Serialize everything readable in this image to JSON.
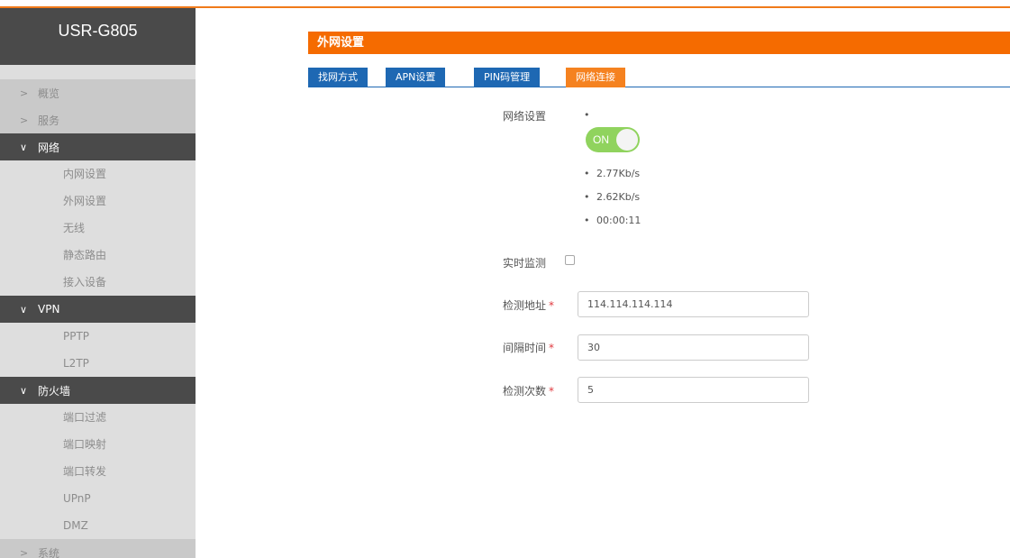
{
  "brand": "USR-G805",
  "sidebar": {
    "groups": [
      {
        "label": "概览",
        "chevron": ">",
        "open": false
      },
      {
        "label": "服务",
        "chevron": ">",
        "open": false
      },
      {
        "label": "网络",
        "chevron": "∨",
        "open": true,
        "items": [
          "内网设置",
          "外网设置",
          "无线",
          "静态路由",
          "接入设备"
        ]
      },
      {
        "label": "VPN",
        "chevron": "∨",
        "open": true,
        "items": [
          "PPTP",
          "L2TP"
        ]
      },
      {
        "label": "防火墙",
        "chevron": "∨",
        "open": true,
        "items": [
          "端口过滤",
          "端口映射",
          "端口转发",
          "UPnP",
          "DMZ"
        ]
      },
      {
        "label": "系统",
        "chevron": ">",
        "open": false
      }
    ]
  },
  "main": {
    "section_title": "外网设置",
    "tabs": [
      {
        "label": "找网方式",
        "active": false
      },
      {
        "label": "APN设置",
        "active": false
      },
      {
        "label": "PIN码管理",
        "active": false
      },
      {
        "label": "网络连接",
        "active": true
      }
    ],
    "network_setting": {
      "label": "网络设置",
      "toggle_text": "ON",
      "toggle_on": true,
      "stats": [
        "2.77Kb/s",
        "2.62Kb/s",
        "00:00:11"
      ]
    },
    "realtime_monitor": {
      "label": "实时监测",
      "checked": false
    },
    "fields": [
      {
        "label": "检测地址",
        "required_mark": "*",
        "value": "114.114.114.114"
      },
      {
        "label": "间隔时间",
        "required_mark": "*",
        "value": "30"
      },
      {
        "label": "检测次数",
        "required_mark": "*",
        "value": "5"
      }
    ]
  },
  "colors": {
    "accent_orange": "#f56b00",
    "tab_blue": "#1e68b3",
    "toggle_green": "#90d35e",
    "sidebar_dark": "#4a4a4a"
  }
}
